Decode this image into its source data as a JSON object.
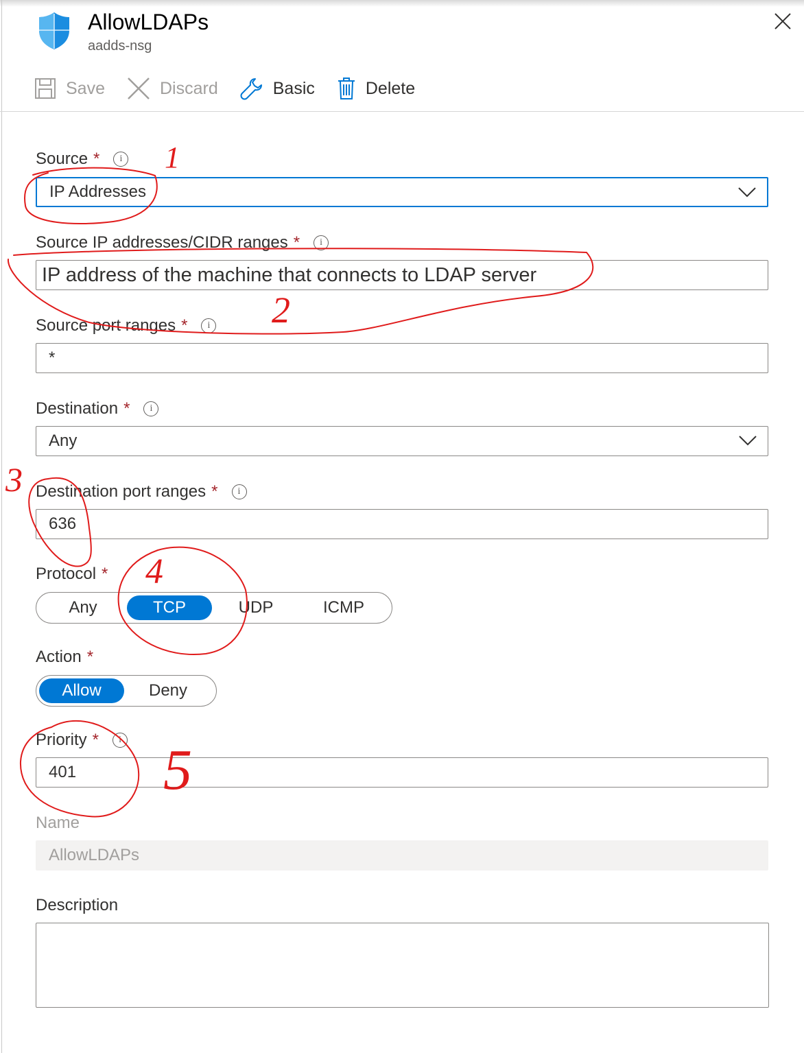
{
  "header": {
    "title": "AllowLDAPs",
    "subtitle": "aadds-nsg",
    "icon": "shield-icon",
    "close_icon": "close-icon"
  },
  "toolbar": {
    "save_label": "Save",
    "discard_label": "Discard",
    "basic_label": "Basic",
    "delete_label": "Delete"
  },
  "form": {
    "source": {
      "label": "Source",
      "required": "*",
      "value": "IP Addresses"
    },
    "source_ip": {
      "label": "Source IP addresses/CIDR ranges",
      "required": "*",
      "value": "IP address of the machine that connects to LDAP server"
    },
    "source_port": {
      "label": "Source port ranges",
      "required": "*",
      "value": "*"
    },
    "destination": {
      "label": "Destination",
      "required": "*",
      "value": "Any"
    },
    "dest_port": {
      "label": "Destination port ranges",
      "required": "*",
      "value": "636"
    },
    "protocol": {
      "label": "Protocol",
      "required": "*",
      "options": [
        "Any",
        "TCP",
        "UDP",
        "ICMP"
      ],
      "selected": "TCP"
    },
    "action": {
      "label": "Action",
      "required": "*",
      "options": [
        "Allow",
        "Deny"
      ],
      "selected": "Allow"
    },
    "priority": {
      "label": "Priority",
      "required": "*",
      "value": "401"
    },
    "name": {
      "label": "Name",
      "value": "AllowLDAPs"
    },
    "description": {
      "label": "Description",
      "value": ""
    }
  },
  "annotations": [
    "1",
    "2",
    "3",
    "4",
    "5"
  ],
  "colors": {
    "accent": "#0078d4",
    "required": "#a4262c",
    "annotation": "#e01b1b"
  }
}
